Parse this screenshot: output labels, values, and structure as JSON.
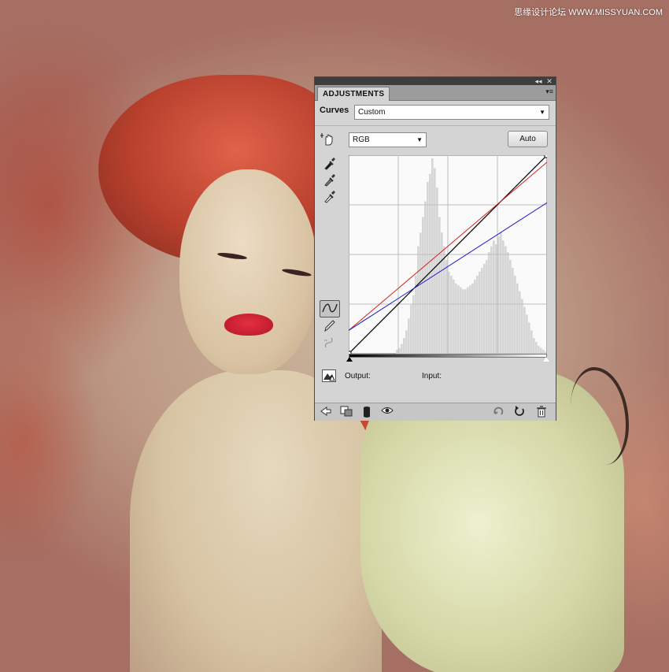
{
  "watermark": "思缘设计论坛 WWW.MISSYUAN.COM",
  "panel": {
    "tab_label": "ADJUSTMENTS",
    "collapse_glyph": "◂◂",
    "close_glyph": "✕",
    "menu_glyph": "▾≡",
    "adjustment_type": "Curves",
    "preset": {
      "selected": "Custom"
    },
    "channel": {
      "selected": "RGB"
    },
    "auto_label": "Auto",
    "output_label": "Output:",
    "input_label": "Input:",
    "icons": {
      "on_image_tool": "hand-adjust-icon",
      "black_eyedropper": "eyedropper-black-icon",
      "gray_eyedropper": "eyedropper-gray-icon",
      "white_eyedropper": "eyedropper-white-icon",
      "curve_mode": "curve-point-icon",
      "pencil_mode": "pencil-icon",
      "smooth": "smooth-curve-icon",
      "clipping_warning": "clipping-warning-icon",
      "back": "back-arrow-icon",
      "clip_layer": "clip-to-layer-icon",
      "visibility_toggle": "layer-mask-icon",
      "eye": "eye-icon",
      "previous_state": "previous-state-icon",
      "reset": "reset-icon",
      "delete": "trash-icon"
    }
  },
  "chart_data": {
    "type": "line",
    "xlim": [
      0,
      255
    ],
    "ylim": [
      0,
      255
    ],
    "grid": true,
    "series": [
      {
        "color": "#000000",
        "x": [
          0,
          255
        ],
        "y": [
          0,
          255
        ]
      },
      {
        "color": "#d42020",
        "x": [
          0,
          255
        ],
        "y": [
          30,
          246
        ]
      },
      {
        "color": "#2020c8",
        "x": [
          0,
          255
        ],
        "y": [
          30,
          194
        ]
      }
    ],
    "histogram": [
      0,
      0,
      0,
      0,
      0,
      0,
      0,
      0,
      0,
      0,
      0,
      0,
      0,
      0,
      0,
      0,
      0,
      0,
      0,
      0,
      2,
      3,
      5,
      8,
      12,
      18,
      25,
      30,
      40,
      55,
      62,
      70,
      78,
      88,
      92,
      100,
      95,
      85,
      70,
      62,
      55,
      48,
      42,
      40,
      38,
      36,
      35,
      34,
      33,
      33,
      34,
      35,
      36,
      38,
      40,
      42,
      44,
      46,
      48,
      52,
      55,
      58,
      56,
      60,
      62,
      58,
      55,
      52,
      48,
      44,
      40,
      36,
      32,
      28,
      24,
      20,
      16,
      12,
      8,
      6,
      4,
      3,
      2,
      1
    ]
  }
}
